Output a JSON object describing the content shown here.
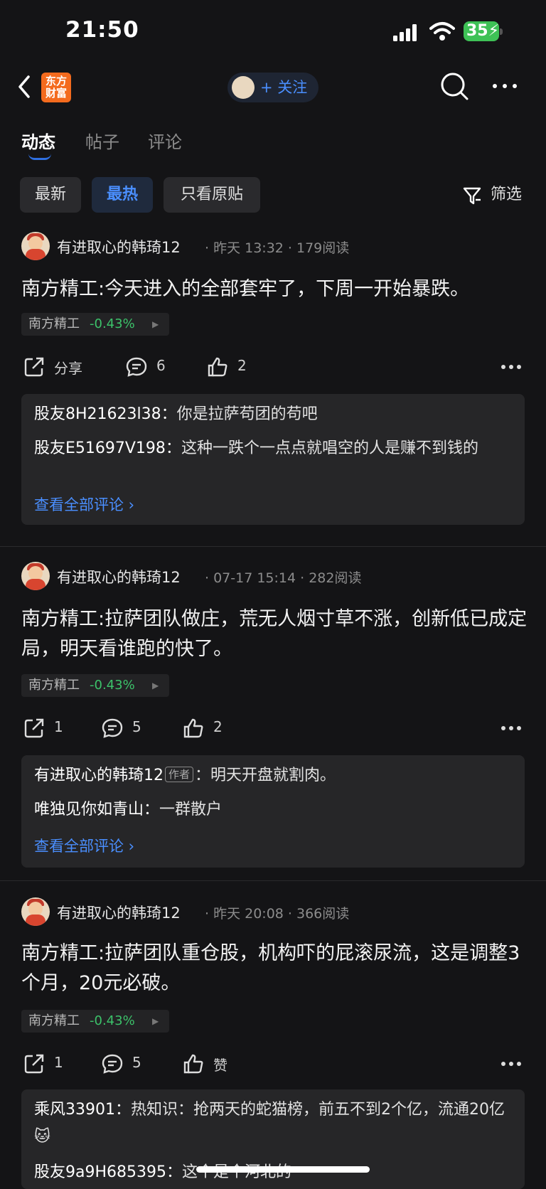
{
  "status_bar": {
    "time": "21:50",
    "battery": "35"
  },
  "nav": {
    "logo_line1": "东方",
    "logo_line2": "财富",
    "follow_label": "+ 关注"
  },
  "tabs": [
    {
      "label": "动态"
    },
    {
      "label": "帖子"
    },
    {
      "label": "评论"
    }
  ],
  "filters": {
    "chips": [
      {
        "label": "最新"
      },
      {
        "label": "最热"
      },
      {
        "label": "只看原贴"
      }
    ],
    "filter_label": "筛选"
  },
  "posts": [
    {
      "author": "有进取心的韩琦12",
      "time": "· 昨天 13:32 · 179阅读",
      "content": "南方精工:今天进入的全部套牢了，下周一开始暴跌。",
      "stock_name": "南方精工",
      "stock_change": "-0.43%",
      "share": "分享",
      "comments": "6",
      "likes": "2",
      "comment_list": [
        {
          "name": "股友8H21623l38：",
          "text": "你是拉萨苟团的苟吧"
        },
        {
          "name": "股友E51697V198：",
          "text": "这种一跌个一点点就唱空的人是赚不到钱的"
        }
      ],
      "view_all": "查看全部评论 ›"
    },
    {
      "author": "有进取心的韩琦12",
      "time": "· 07-17 15:14 · 282阅读",
      "content": "南方精工:拉萨团队做庄，荒无人烟寸草不涨，创新低已成定局，明天看谁跑的快了。",
      "stock_name": "南方精工",
      "stock_change": "-0.43%",
      "share": "1",
      "comments": "5",
      "likes": "2",
      "comment_list": [
        {
          "name": "有进取心的韩琦12",
          "badge": "作者",
          "text": "：明天开盘就割肉。"
        },
        {
          "name": "唯独见你如青山：",
          "text": "一群散户"
        }
      ],
      "view_all": "查看全部评论 ›"
    },
    {
      "author": "有进取心的韩琦12",
      "time": "· 昨天 20:08 · 366阅读",
      "content": "南方精工:拉萨团队重仓股，机构吓的屁滚尿流，这是调整3个月，20元必破。",
      "stock_name": "南方精工",
      "stock_change": "-0.43%",
      "share": "1",
      "comments": "5",
      "likes": "赞",
      "comment_list": [
        {
          "name": "乘风33901：",
          "text": "热知识：抢两天的蛇猫榜，前五不到2个亿，流通20亿🐱"
        },
        {
          "name": "股友9a9H685395：",
          "text": "这个是个河北的"
        }
      ]
    }
  ]
}
